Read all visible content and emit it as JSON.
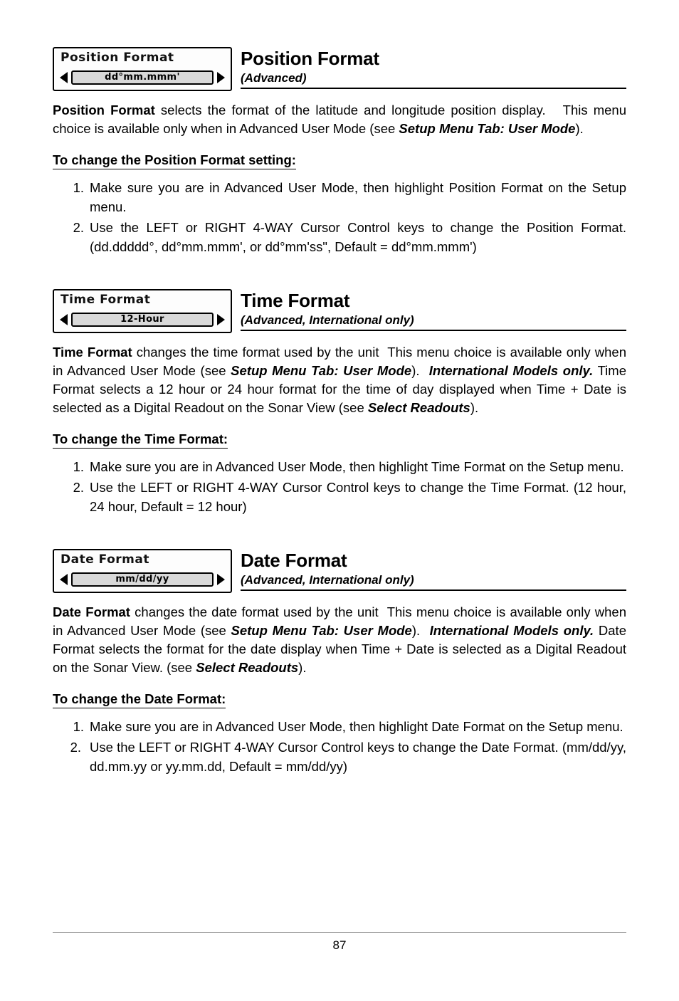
{
  "page": {
    "number": "87"
  },
  "sections": [
    {
      "lcd": {
        "title": "Position Format",
        "value": "dd°mm.mmm'",
        "left_arrow": "left-arrow-icon",
        "right_arrow": "right-arrow-icon"
      },
      "title": "Position Format",
      "subtitle": "(Advanced)",
      "paragraphs": [
        "Position Format selects the format of the latitude and longitude position display.   This menu choice is available only when in Advanced User Mode (see Setup Menu Tab: User Mode)."
      ],
      "howto": "To change the Position Format setting:",
      "steps": [
        {
          "num": "1.",
          "text": "Make sure you are in Advanced User Mode, then highlight Position Format on the Setup menu."
        },
        {
          "num": "2.",
          "text": "Use the LEFT or RIGHT 4-WAY Cursor Control keys to change the Position Format. (dd.ddddd°, dd°mm.mmm', or dd°mm'ss\", Default = dd°mm.mmm')"
        }
      ]
    },
    {
      "lcd": {
        "title": "Time Format",
        "value": "12-Hour",
        "left_arrow": "left-arrow-icon",
        "right_arrow": "right-arrow-icon"
      },
      "title": "Time Format",
      "subtitle": "(Advanced, International only)",
      "paragraphs": [
        "Time Format changes the time format used by the unit  This menu choice is available only when in Advanced User Mode (see Setup Menu Tab: User Mode).  International Models only. Time Format selects a 12 hour or 24 hour format for the time of day displayed when Time + Date is selected as a Digital Readout on the Sonar View (see Select Readouts)."
      ],
      "howto": "To change the Time Format:",
      "steps": [
        {
          "num": "1.",
          "text": "Make sure you are in Advanced User Mode, then highlight Time Format on the Setup menu."
        },
        {
          "num": "2.",
          "text": "Use the LEFT or RIGHT 4-WAY Cursor Control keys to change the Time Format. (12 hour, 24 hour, Default = 12 hour)"
        }
      ]
    },
    {
      "lcd": {
        "title": "Date Format",
        "value": "mm/dd/yy",
        "left_arrow": "left-arrow-icon",
        "right_arrow": "right-arrow-icon"
      },
      "title": "Date Format",
      "subtitle": "(Advanced, International only)",
      "paragraphs": [
        "Date Format changes the date format used by the unit  This menu choice is available only when in Advanced User Mode (see Setup Menu Tab: User Mode).  International Models only. Date Format selects the format for the date display when Time + Date is selected as a Digital Readout on the Sonar View. (see Select Readouts)."
      ],
      "howto": "To change the Date Format:",
      "steps": [
        {
          "num": "1.",
          "text": "Make sure you are in Advanced User Mode, then highlight Date Format on the Setup menu."
        },
        {
          "num": "2.",
          "text": "Use the LEFT or RIGHT 4-WAY Cursor Control keys to change the Date Format. (mm/dd/yy, dd.mm.yy or yy.mm.dd, Default = mm/dd/yy)"
        }
      ]
    }
  ]
}
